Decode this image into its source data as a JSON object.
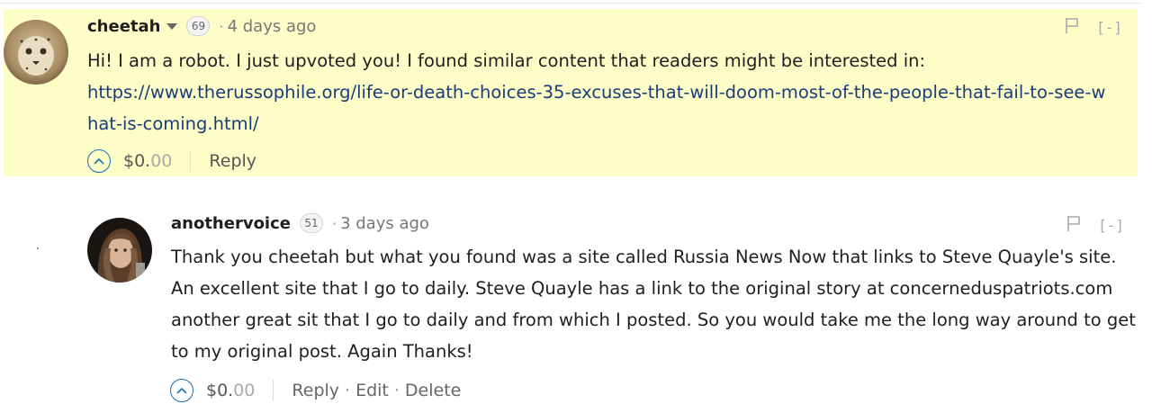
{
  "comments": [
    {
      "author": "cheetah",
      "reputation": "69",
      "separator": "·",
      "time": "4 days ago",
      "flag_icon": "flag-icon",
      "collapse_label": "[-]",
      "body_text": "Hi! I am a robot. I just upvoted you! I found similar content that readers might be interested in:",
      "body_link": "https://www.therussophile.org/life-or-death-choices-35-excuses-that-will-doom-most-of-the-people-that-fail-to-see-what-is-coming.html/",
      "payout_main": "$0.",
      "payout_cents": "00",
      "reply_label": "Reply",
      "highlight_color": "#fdfdc8"
    },
    {
      "author": "anothervoice",
      "reputation": "51",
      "separator": "·",
      "time": "3 days ago",
      "flag_icon": "flag-icon",
      "collapse_label": "[-]",
      "body_text": "Thank you cheetah but what you found was a site called Russia News Now that links to Steve Quayle's site. An excellent site that I go to daily. Steve Quayle has a link to the original story at concerneduspatriots.com another great sit that I go to daily and from which I posted. So you would take me the long way around to get to my original post. Again Thanks!",
      "payout_main": "$0.",
      "payout_cents": "00",
      "reply_label": "Reply",
      "edit_label": "Edit",
      "delete_label": "Delete",
      "action_separator": "·"
    }
  ],
  "colors": {
    "link": "#1a3c7a",
    "upvote": "#1a6fb3"
  }
}
